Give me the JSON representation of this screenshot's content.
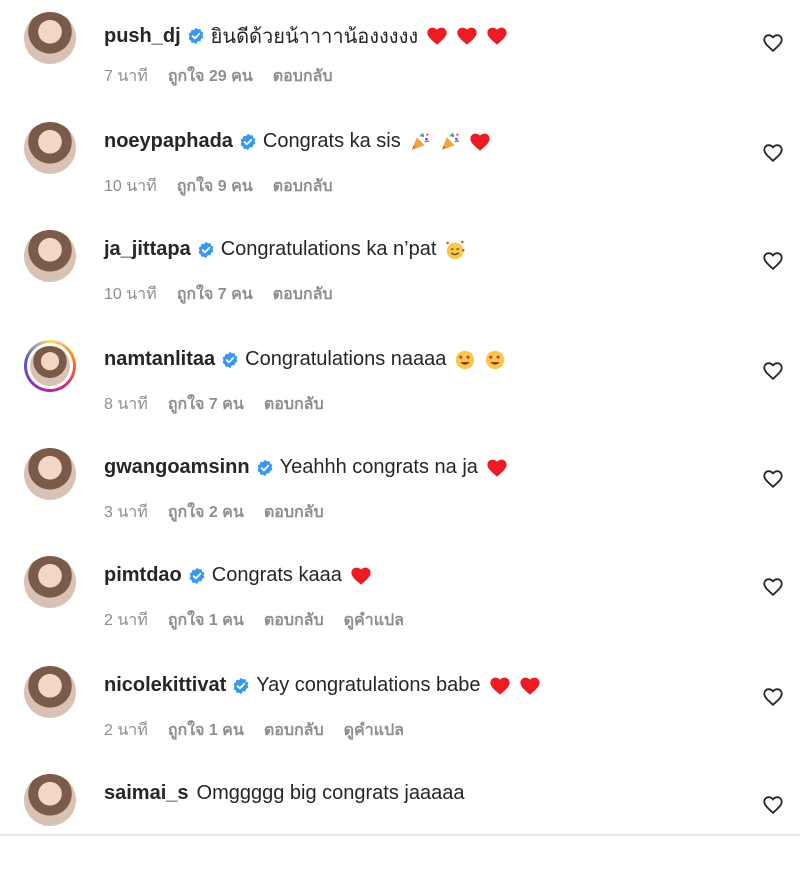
{
  "comments": [
    {
      "username": "push_dj",
      "text": "ยินดีด้วยน้าาาาน้องงงงง",
      "emojis": [
        "red-heart",
        "red-heart",
        "red-heart"
      ],
      "time": "7 นาที",
      "likes": "ถูกใจ 29 คน",
      "reply": "ตอบกลับ",
      "translate": "",
      "story_ring": false
    },
    {
      "username": "noeypaphada",
      "text": "Congrats ka sis",
      "emojis": [
        "party-popper",
        "party-popper",
        "red-heart"
      ],
      "time": "10 นาที",
      "likes": "ถูกใจ 9 คน",
      "reply": "ตอบกลับ",
      "translate": "",
      "story_ring": false
    },
    {
      "username": "ja_jittapa",
      "text": "Congratulations ka n’pat",
      "emojis": [
        "smiling-face-with-hearts"
      ],
      "time": "10 นาที",
      "likes": "ถูกใจ 7 คน",
      "reply": "ตอบกลับ",
      "translate": "",
      "story_ring": false
    },
    {
      "username": "namtanlitaa",
      "text": "Congratulations naaaa",
      "emojis": [
        "heart-eyes",
        "heart-eyes"
      ],
      "time": "8 นาที",
      "likes": "ถูกใจ 7 คน",
      "reply": "ตอบกลับ",
      "translate": "",
      "story_ring": true
    },
    {
      "username": "gwangoamsinn",
      "text": "Yeahhh congrats na ja",
      "emojis": [
        "red-heart"
      ],
      "time": "3 นาที",
      "likes": "ถูกใจ 2 คน",
      "reply": "ตอบกลับ",
      "translate": "",
      "story_ring": false
    },
    {
      "username": "pimtdao",
      "text": "Congrats kaaa",
      "emojis": [
        "red-heart"
      ],
      "time": "2 นาที",
      "likes": "ถูกใจ 1 คน",
      "reply": "ตอบกลับ",
      "translate": "ดูคำแปล",
      "story_ring": false
    },
    {
      "username": "nicolekittivat",
      "text": "Yay congratulations babe",
      "emojis": [
        "red-heart",
        "red-heart"
      ],
      "time": "2 นาที",
      "likes": "ถูกใจ 1 คน",
      "reply": "ตอบกลับ",
      "translate": "ดูคำแปล",
      "story_ring": false
    },
    {
      "username": "saimai_s",
      "text": "Omggggg big congrats jaaaaa",
      "emojis": [],
      "time": "",
      "likes": "",
      "reply": "",
      "translate": "",
      "story_ring": false
    }
  ],
  "colors": {
    "verified": "#3897f0",
    "heart": "#ed1c24",
    "meta_text": "#8e8e8e",
    "username": "#262626"
  },
  "icons": {
    "verified": "verified-badge-icon",
    "like": "heart-outline-icon"
  }
}
